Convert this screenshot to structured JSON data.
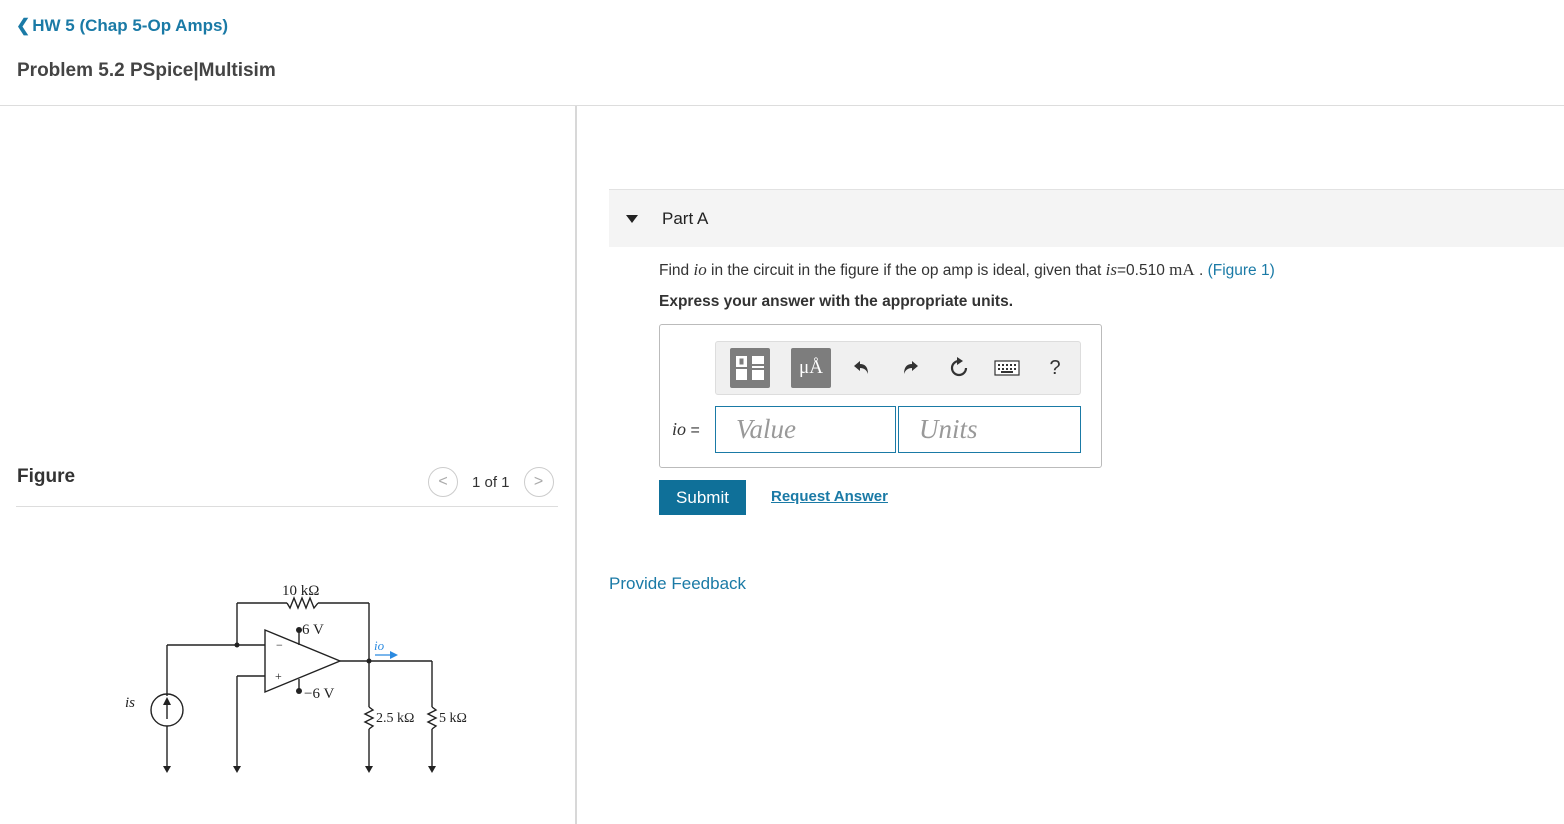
{
  "nav": {
    "back_label": "HW 5 (Chap 5-Op Amps)"
  },
  "problem": {
    "title": "Problem 5.2 PSpice|Multisim"
  },
  "figure": {
    "heading": "Figure",
    "pager": "1 of 1",
    "prev_glyph": "<",
    "next_glyph": ">",
    "circuit_labels": {
      "feedback_resistor": "10 kΩ",
      "pos_supply": "6 V",
      "neg_supply": "−6 V",
      "output_current": "io",
      "source_label": "is",
      "load_resistor_1": "2.5 kΩ",
      "load_resistor_2": "5 kΩ"
    }
  },
  "part_a": {
    "label": "Part A",
    "question_prefix": "Find",
    "question_var": "io",
    "question_middle": "in the circuit in the figure if the op amp is ideal, given that",
    "given_var": "is",
    "given_value": "=0.510",
    "given_unit": "mA",
    "figure_link": "(Figure 1)",
    "instructions": "Express your answer with the appropriate units.",
    "answer_var": "io",
    "answer_eq": "=",
    "value_placeholder": "Value",
    "units_placeholder": "Units",
    "toolbar": {
      "units_glyph": "μÅ",
      "help_glyph": "?"
    },
    "submit_label": "Submit",
    "request_label": "Request Answer"
  },
  "feedback": {
    "label": "Provide Feedback"
  },
  "colors": {
    "link": "#1a7aa6",
    "submit_bg": "#0f7099"
  }
}
